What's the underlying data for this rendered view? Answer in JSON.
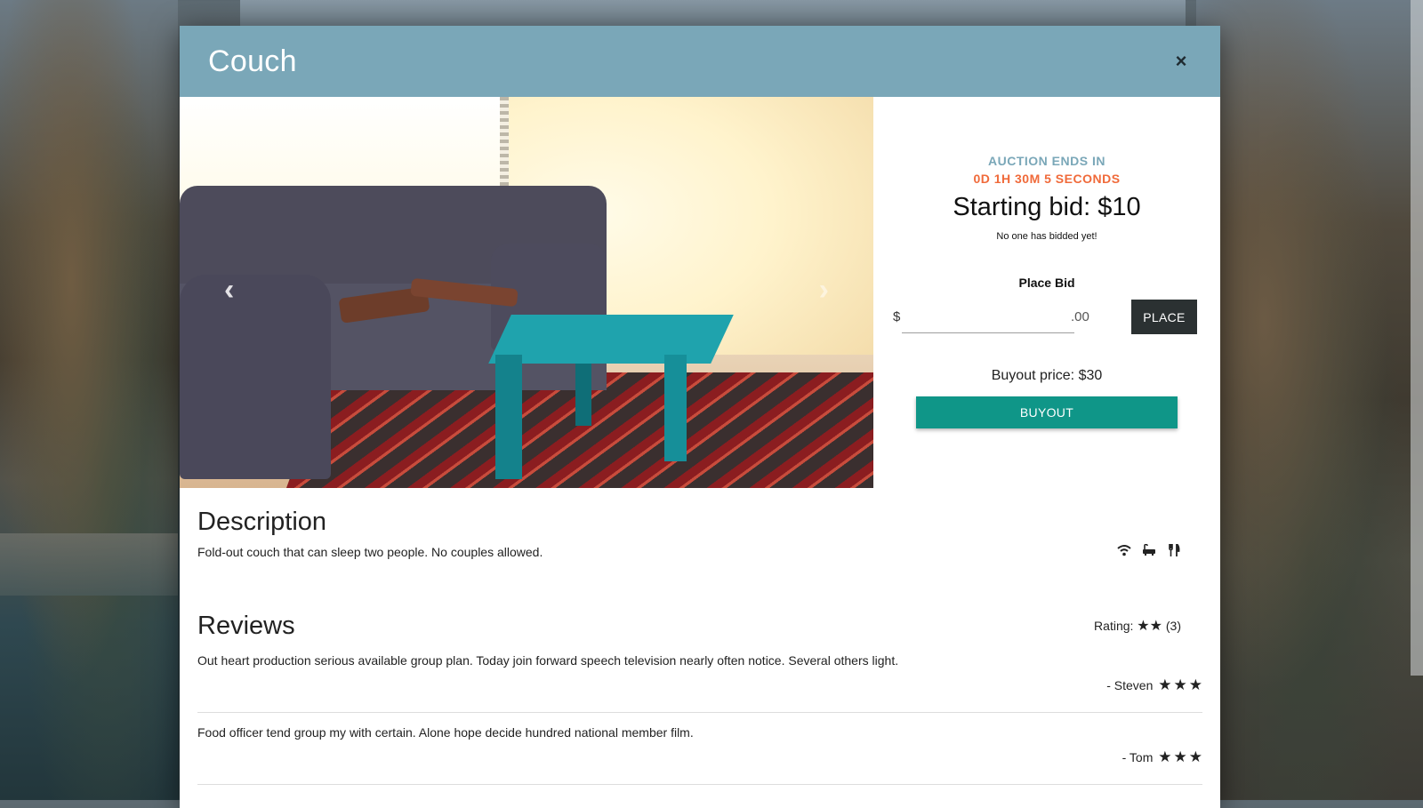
{
  "modal": {
    "title": "Couch",
    "close_label": "×"
  },
  "carousel": {
    "prev_label": "‹",
    "next_label": "›"
  },
  "auction": {
    "ends_label": "AUCTION ENDS IN",
    "countdown": "0D 1H 30M 5 SECONDS",
    "starting_bid": "Starting bid: $10",
    "bid_status": "No one has bidded yet!",
    "place_bid_label": "Place Bid",
    "currency_symbol": "$",
    "bid_value": "",
    "cents": ".00",
    "place_button": "PLACE",
    "buyout_price": "Buyout price: $30",
    "buyout_button": "BUYOUT"
  },
  "description": {
    "heading": "Description",
    "text": "Fold-out couch that can sleep two people. No couples allowed.",
    "amenity_icons": [
      "wifi-icon",
      "bathtub-icon",
      "utensils-icon"
    ]
  },
  "reviews": {
    "heading": "Reviews",
    "rating_label": "Rating:",
    "rating_stars": 2,
    "rating_count": "(3)",
    "items": [
      {
        "text": "Out heart production serious available group plan. Today join forward speech television nearly often notice. Several others light.",
        "author": "- Steven",
        "stars": 3
      },
      {
        "text": "Food officer tend group my with certain. Alone hope decide hundred national member film.",
        "author": "- Tom",
        "stars": 3
      }
    ]
  },
  "colors": {
    "header": "#7aa7b8",
    "countdown": "#f06a3a",
    "buyout": "#0f9688",
    "place": "#2b3132"
  }
}
